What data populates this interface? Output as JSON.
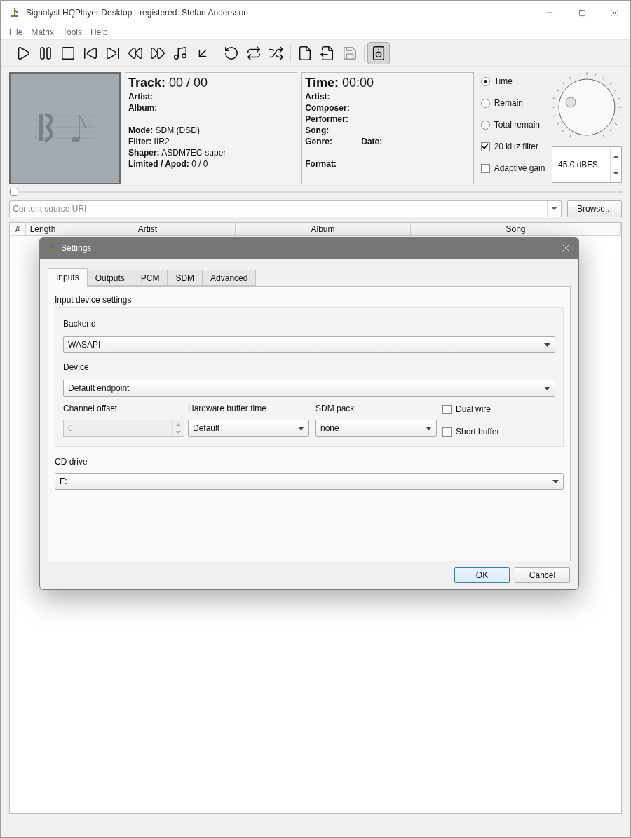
{
  "window": {
    "title": "Signalyst HQPlayer Desktop - registered: Stefan Andersson"
  },
  "menu": [
    {
      "label": "File"
    },
    {
      "label": "Matrix"
    },
    {
      "label": "Tools"
    },
    {
      "label": "Help"
    }
  ],
  "toolbar": [
    {
      "kind": "play",
      "disabled": false,
      "pressed": false
    },
    {
      "kind": "pause",
      "disabled": false,
      "pressed": false
    },
    {
      "kind": "stop",
      "disabled": false,
      "pressed": false
    },
    {
      "kind": "previous",
      "disabled": false,
      "pressed": false
    },
    {
      "kind": "next",
      "disabled": false,
      "pressed": false
    },
    {
      "kind": "rewind",
      "disabled": false,
      "pressed": false
    },
    {
      "kind": "forward",
      "disabled": false,
      "pressed": false
    },
    {
      "kind": "music",
      "disabled": false,
      "pressed": false
    },
    {
      "kind": "down",
      "disabled": false,
      "pressed": false
    },
    {
      "kind": "sep"
    },
    {
      "kind": "undo",
      "disabled": false,
      "pressed": false
    },
    {
      "kind": "repeat",
      "disabled": false,
      "pressed": false
    },
    {
      "kind": "shuffle",
      "disabled": false,
      "pressed": false
    },
    {
      "kind": "sep"
    },
    {
      "kind": "file",
      "disabled": false,
      "pressed": false
    },
    {
      "kind": "export",
      "disabled": false,
      "pressed": false
    },
    {
      "kind": "save",
      "disabled": true,
      "pressed": false
    },
    {
      "kind": "sep"
    },
    {
      "kind": "speaker",
      "disabled": false,
      "pressed": true
    }
  ],
  "track_panel": {
    "heading_label": "Track:",
    "heading_value": "00 / 00",
    "lines": [
      {
        "label": "Artist:"
      },
      {
        "label": "Album:"
      },
      {
        "kind": "gap"
      },
      {
        "label": "Mode:",
        "value": "SDM (DSD)"
      },
      {
        "label": "Filter:",
        "value": "IIR2"
      },
      {
        "label": "Shaper:",
        "value": "ASDM7EC-super"
      },
      {
        "label": "Limited / Apod:",
        "value": "0 / 0"
      }
    ]
  },
  "time_panel": {
    "heading_label": "Time:",
    "heading_value": "00:00",
    "lines": [
      {
        "label": "Artist:"
      },
      {
        "label": "Composer:"
      },
      {
        "label": "Performer:"
      },
      {
        "label": "Song:"
      },
      {
        "label": "Genre:",
        "second_label": "Date:"
      },
      {
        "kind": "gap"
      },
      {
        "label": "Format:"
      }
    ]
  },
  "time_modes": [
    {
      "label": "Time",
      "selected": true
    },
    {
      "label": "Remain",
      "selected": false
    },
    {
      "label": "Total remain",
      "selected": false
    }
  ],
  "options": [
    {
      "label": "20 kHz filter",
      "checked": true
    },
    {
      "label": "Adaptive gain",
      "checked": false
    }
  ],
  "volume": {
    "reading": "-45.0 dBFS"
  },
  "position": {
    "level": 0
  },
  "source": {
    "placeholder": "Content source URI",
    "browse": "Browse..."
  },
  "table": {
    "columns": [
      "#",
      "Length",
      "Artist",
      "Album",
      "Song"
    ]
  },
  "dialog": {
    "title": "Settings",
    "tabs": [
      {
        "label": "Inputs",
        "selected": true
      },
      {
        "label": "Outputs",
        "selected": false
      },
      {
        "label": "PCM",
        "selected": false
      },
      {
        "label": "SDM",
        "selected": false
      },
      {
        "label": "Advanced",
        "selected": false
      }
    ],
    "group_title": "Input device settings",
    "backend": {
      "label": "Backend",
      "value": "WASAPI"
    },
    "device": {
      "label": "Device",
      "value": "Default endpoint"
    },
    "channel_offset": {
      "label": "Channel offset",
      "value": "0",
      "disabled": true
    },
    "buffer_time": {
      "label": "Hardware buffer time",
      "value": "Default"
    },
    "sdm_pack": {
      "label": "SDM pack",
      "value": "none"
    },
    "checks": [
      {
        "label": "Dual wire",
        "checked": false
      },
      {
        "label": "Short buffer",
        "checked": false
      }
    ],
    "cd_drive": {
      "label": "CD drive",
      "value": "F:"
    },
    "buttons": [
      {
        "label": "OK",
        "default": true
      },
      {
        "label": "Cancel",
        "default": false
      }
    ]
  }
}
